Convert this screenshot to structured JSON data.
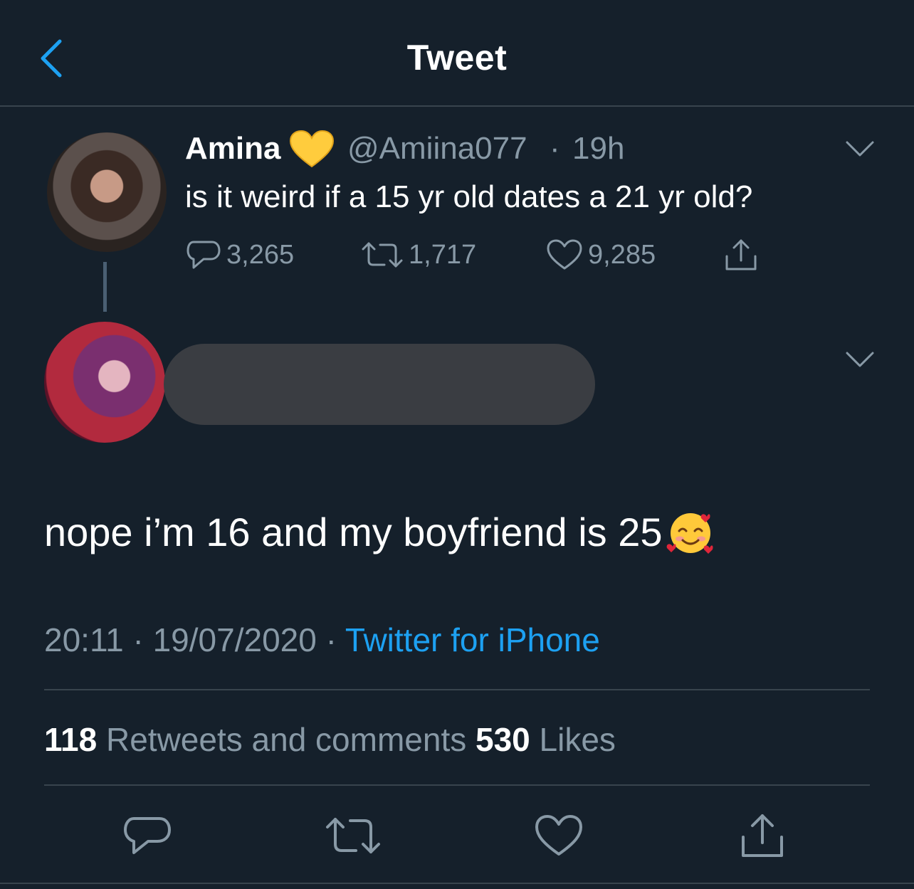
{
  "header": {
    "title": "Tweet"
  },
  "parent_tweet": {
    "name": "Amina",
    "handle": "@Amiina077",
    "separator": "·",
    "time": "19h",
    "text": "is it weird if a 15 yr old dates a 21 yr old?",
    "replies": "3,265",
    "retweets": "1,717",
    "likes": "9,285"
  },
  "reply_tweet": {
    "text": "nope i’m 16 and my boyfriend is 25",
    "emoji_icon": "smiling-face-with-hearts-icon"
  },
  "meta": {
    "time": "20:11",
    "sep1": " · ",
    "date": "19/07/2020",
    "sep2": " · ",
    "source": "Twitter for iPhone"
  },
  "stats": {
    "retweets_count": "118",
    "retweets_label": " Retweets and comments ",
    "likes_count": "530",
    "likes_label": " Likes"
  },
  "colors": {
    "background": "#15202b",
    "accent": "#1da1f2",
    "secondary_text": "#8899a6",
    "divider": "#38444d"
  }
}
